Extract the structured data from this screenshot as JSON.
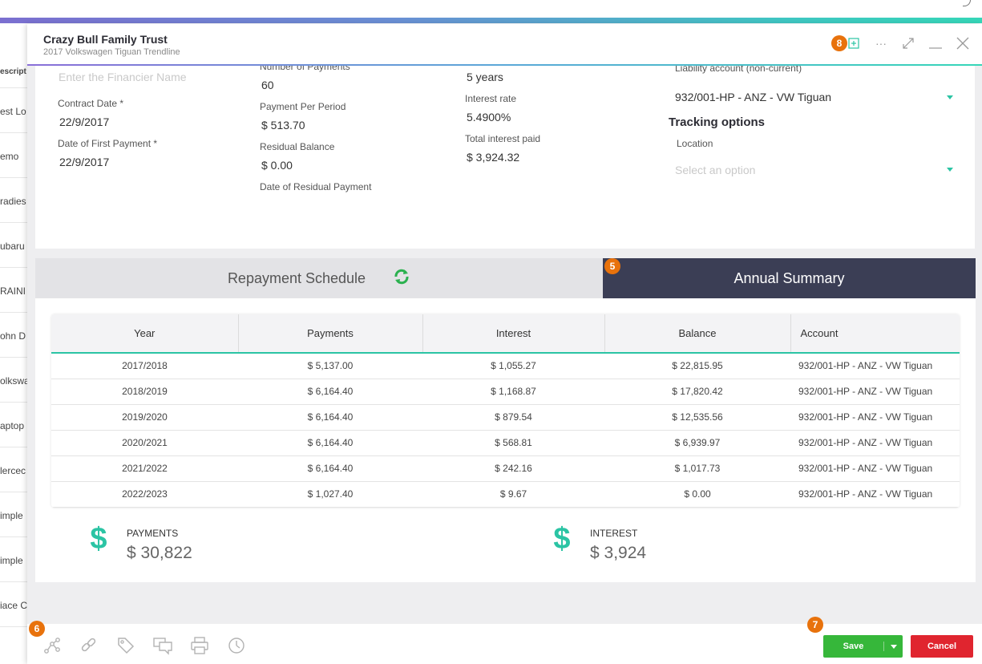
{
  "background_list": {
    "header": "escript",
    "rows": [
      "est Lo",
      "emo",
      "radies",
      "ubaru",
      "RAINI",
      "ohn D",
      "olkswa",
      "aptop",
      "lercec",
      "imple",
      "imple",
      "iace C"
    ]
  },
  "modal": {
    "title": "Crazy Bull Family Trust",
    "subtitle": "2017 Volkswagen Tiguan Trendline",
    "header_badge": "8"
  },
  "form": {
    "financier_placeholder": "Enter the Financier Name",
    "contract_date_label": "Contract Date *",
    "contract_date_value": "22/9/2017",
    "first_payment_label": "Date of First Payment *",
    "first_payment_value": "22/9/2017",
    "num_payments_label": "Number of Payments",
    "num_payments_value": "60",
    "payment_period_label": "Payment Per Period",
    "payment_period_value": "$ 513.70",
    "residual_balance_label": "Residual Balance",
    "residual_balance_value": "$ 0.00",
    "residual_payment_label": "Date of Residual Payment",
    "term_value": "5 years",
    "interest_rate_label": "Interest rate",
    "interest_rate_value": "5.4900%",
    "total_interest_label": "Total interest paid",
    "total_interest_value": "$ 3,924.32",
    "liability_label": "Liability account (non-current)",
    "liability_value": "932/001-HP - ANZ - VW Tiguan",
    "tracking_title": "Tracking options",
    "location_label": "Location",
    "location_placeholder": "Select an option"
  },
  "tabs": {
    "repayment": "Repayment Schedule",
    "annual": "Annual Summary",
    "annual_badge": "5"
  },
  "table": {
    "headers": [
      "Year",
      "Payments",
      "Interest",
      "Balance",
      "Account"
    ],
    "rows": [
      [
        "2017/2018",
        "$ 5,137.00",
        "$ 1,055.27",
        "$ 22,815.95",
        "932/001-HP - ANZ - VW Tiguan"
      ],
      [
        "2018/2019",
        "$ 6,164.40",
        "$ 1,168.87",
        "$ 17,820.42",
        "932/001-HP - ANZ - VW Tiguan"
      ],
      [
        "2019/2020",
        "$ 6,164.40",
        "$ 879.54",
        "$ 12,535.56",
        "932/001-HP - ANZ - VW Tiguan"
      ],
      [
        "2020/2021",
        "$ 6,164.40",
        "$ 568.81",
        "$ 6,939.97",
        "932/001-HP - ANZ - VW Tiguan"
      ],
      [
        "2021/2022",
        "$ 6,164.40",
        "$ 242.16",
        "$ 1,017.73",
        "932/001-HP - ANZ - VW Tiguan"
      ],
      [
        "2022/2023",
        "$ 1,027.40",
        "$ 9.67",
        "$ 0.00",
        "932/001-HP - ANZ - VW Tiguan"
      ]
    ]
  },
  "summary": {
    "dollar_glyph": "$",
    "payments_label": "PAYMENTS",
    "payments_value": "$ 30,822",
    "interest_label": "INTEREST",
    "interest_value": "$ 3,924"
  },
  "footer": {
    "left_badge": "6",
    "right_badge": "7",
    "save_label": "Save",
    "cancel_label": "Cancel",
    "icons": [
      "workflow-icon",
      "link-icon",
      "tag-icon",
      "comments-icon",
      "print-icon",
      "history-icon"
    ]
  },
  "colors": {
    "accent": "#2bc4a4",
    "tab_active": "#3b3e55",
    "badge": "#e8720c",
    "save": "#36b73a",
    "cancel": "#e0252f"
  }
}
